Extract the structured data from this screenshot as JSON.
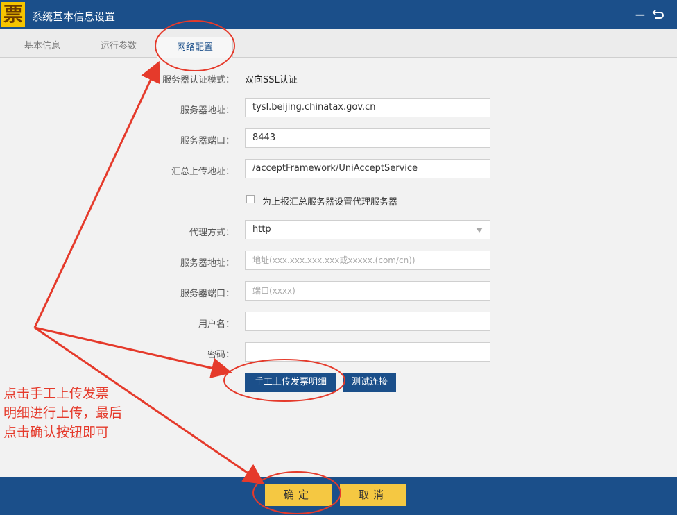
{
  "window": {
    "logo_char": "票",
    "title": "系统基本信息设置",
    "minimize_glyph": "−",
    "restore_glyph": "⮌"
  },
  "tabs": [
    {
      "label": "基本信息",
      "active": false
    },
    {
      "label": "运行参数",
      "active": false
    },
    {
      "label": "网络配置",
      "active": true
    }
  ],
  "form": {
    "auth_mode_label": "服务器认证模式：",
    "auth_mode_value": "双向SSL认证",
    "server_address_label": "服务器地址：",
    "server_address_value": "tysl.beijing.chinatax.gov.cn",
    "server_port_label": "服务器端口：",
    "server_port_value": "8443",
    "summary_upload_label": "汇总上传地址：",
    "summary_upload_value": "/acceptFramework/UniAcceptService",
    "proxy_checkbox_label": "为上报汇总服务器设置代理服务器",
    "proxy_checked": false,
    "proxy_mode_label": "代理方式：",
    "proxy_mode_value": "http",
    "proxy_address_label": "服务器地址：",
    "proxy_address_placeholder": "地址(xxx.xxx.xxx.xxx或xxxxx.(com/cn))",
    "proxy_port_label": "服务器端口：",
    "proxy_port_placeholder": "端口(xxxx)",
    "username_label": "用户名：",
    "username_value": "",
    "password_label": "密码：",
    "password_value": ""
  },
  "actions": {
    "manual_upload_label": "手工上传发票明细",
    "test_connection_label": "测试连接",
    "confirm_label": "确定",
    "cancel_label": "取消"
  },
  "annotation": {
    "text": "点击手工上传发票\n明细进行上传，最后\n点击确认按钮即可",
    "color": "#e53a2b"
  },
  "colors": {
    "primary_blue": "#1b4f8a",
    "button_yellow": "#f5c842",
    "annotation_red": "#e53a2b"
  }
}
